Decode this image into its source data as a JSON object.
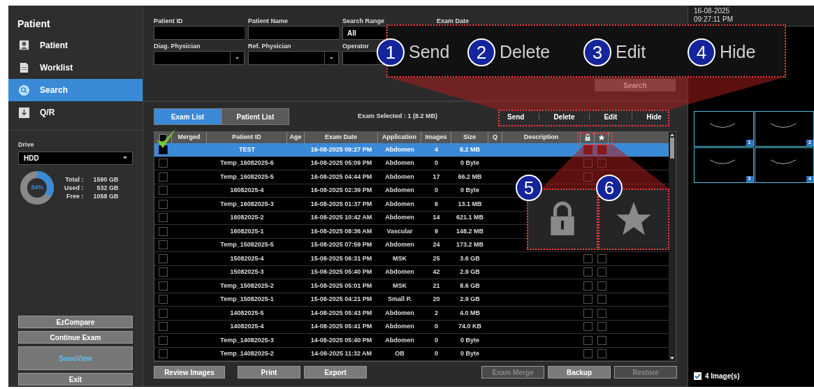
{
  "sidebar": {
    "title": "Patient",
    "items": [
      {
        "label": "Patient",
        "selected": false
      },
      {
        "label": "Worklist",
        "selected": false
      },
      {
        "label": "Search",
        "selected": true
      },
      {
        "label": "Q/R",
        "selected": false
      }
    ],
    "drive": {
      "label": "Drive",
      "value": "HDD",
      "level": 0.34,
      "percent": "34%",
      "stats": [
        {
          "label": "Total :",
          "value": "1590 GB"
        },
        {
          "label": "Used :",
          "value": "532 GB"
        },
        {
          "label": "Free :",
          "value": "1058 GB"
        }
      ]
    },
    "buttons": [
      {
        "label": "EzCompare",
        "kind": "small",
        "active": false
      },
      {
        "label": "Continue Exam",
        "kind": "small",
        "active": false
      },
      {
        "label": "SonoView",
        "kind": "tall",
        "active": true
      },
      {
        "label": "Exit",
        "kind": "small",
        "active": false
      }
    ]
  },
  "search_form": {
    "fields": [
      {
        "label": "Patient ID",
        "kind": "text"
      },
      {
        "label": "Patient Name",
        "kind": "text"
      },
      {
        "label": "Search Range",
        "kind": "value",
        "value": "All"
      },
      {
        "label": "Exam Date",
        "kind": "label"
      },
      {
        "label": "Diag. Physician",
        "kind": "select"
      },
      {
        "label": "Ref. Physician",
        "kind": "select"
      },
      {
        "label": "Operator",
        "kind": "text"
      }
    ],
    "search_button": "Search"
  },
  "tabs": [
    {
      "label": "Exam List",
      "selected": true
    },
    {
      "label": "Patient List",
      "selected": false
    }
  ],
  "exam_selected": "Exam Selected : 1 (8.2 MB)",
  "actions": [
    "Send",
    "Delete",
    "Edit",
    "Hide"
  ],
  "table": {
    "columns": [
      {
        "kind": "checkbox",
        "checked": false
      },
      {
        "kind": "text",
        "label": "Merged"
      },
      {
        "kind": "text",
        "label": "Patient ID"
      },
      {
        "kind": "text",
        "label": "Age"
      },
      {
        "kind": "text",
        "label": "Exam Date"
      },
      {
        "kind": "text",
        "label": "Application"
      },
      {
        "kind": "text",
        "label": "Images"
      },
      {
        "kind": "text",
        "label": "Size"
      },
      {
        "kind": "text",
        "label": "Q"
      },
      {
        "kind": "text",
        "label": "Description"
      },
      {
        "kind": "lock"
      },
      {
        "kind": "star"
      }
    ],
    "rows": [
      {
        "checked": true,
        "selected": true,
        "patient_id": "TEST",
        "exam_date": "16-08-2025 09:27 PM",
        "application": "Abdomen",
        "images": "4",
        "size": "8.2 MB",
        "locked": true,
        "starred": true
      },
      {
        "checked": false,
        "selected": false,
        "patient_id": "Temp_16082025-6",
        "exam_date": "16-08-2025 05:09 PM",
        "application": "Abdomen",
        "images": "0",
        "size": "0 Byte",
        "locked": false,
        "starred": false
      },
      {
        "checked": false,
        "selected": false,
        "patient_id": "Temp_16082025-5",
        "exam_date": "16-08-2025 04:44 PM",
        "application": "Abdomen",
        "images": "17",
        "size": "66.2 MB",
        "locked": false
      },
      {
        "checked": false,
        "selected": false,
        "patient_id": "16082025-4",
        "exam_date": "16-08-2025 02:39 PM",
        "application": "Abdomen",
        "images": "0",
        "size": "0 Byte"
      },
      {
        "checked": false,
        "selected": false,
        "patient_id": "Temp_16082025-3",
        "exam_date": "16-08-2025 01:37 PM",
        "application": "Abdomen",
        "images": "6",
        "size": "13.1 MB"
      },
      {
        "checked": false,
        "selected": false,
        "patient_id": "16082025-2",
        "exam_date": "16-08-2025 10:42 AM",
        "application": "Abdomen",
        "images": "14",
        "size": "621.1 MB"
      },
      {
        "checked": false,
        "selected": false,
        "patient_id": "16082025-1",
        "exam_date": "16-08-2025 08:36 AM",
        "application": "Vascular",
        "images": "9",
        "size": "148.2 MB"
      },
      {
        "checked": false,
        "selected": false,
        "patient_id": "Temp_15082025-5",
        "exam_date": "15-08-2025 07:59 PM",
        "application": "Abdomen",
        "images": "24",
        "size": "173.2 MB"
      },
      {
        "checked": false,
        "selected": false,
        "patient_id": "15082025-4",
        "exam_date": "15-08-2025 06:31 PM",
        "application": "MSK",
        "images": "25",
        "size": "3.6 GB",
        "locked": false,
        "starred": false
      },
      {
        "checked": false,
        "selected": false,
        "patient_id": "15082025-3",
        "exam_date": "15-08-2025 05:40 PM",
        "application": "Abdomen",
        "images": "42",
        "size": "2.9 GB",
        "locked": false,
        "starred": false
      },
      {
        "checked": false,
        "selected": false,
        "patient_id": "Temp_15082025-2",
        "exam_date": "15-08-2025 05:01 PM",
        "application": "MSK",
        "images": "21",
        "size": "8.6 GB",
        "locked": false,
        "starred": false
      },
      {
        "checked": false,
        "selected": false,
        "patient_id": "Temp_15082025-1",
        "exam_date": "15-08-2025 04:21 PM",
        "application": "Small P.",
        "images": "20",
        "size": "2.9 GB",
        "locked": false,
        "starred": false
      },
      {
        "checked": false,
        "selected": false,
        "patient_id": "14082025-5",
        "exam_date": "14-08-2025 05:43 PM",
        "application": "Abdomen",
        "images": "2",
        "size": "4.0 MB",
        "locked": false,
        "starred": false
      },
      {
        "checked": false,
        "selected": false,
        "patient_id": "14082025-4",
        "exam_date": "14-08-2025 05:41 PM",
        "application": "Abdomen",
        "images": "0",
        "size": "74.0 KB",
        "locked": false,
        "starred": false
      },
      {
        "checked": false,
        "selected": false,
        "patient_id": "Temp_14082025-3",
        "exam_date": "14-08-2025 05:40 PM",
        "application": "Abdomen",
        "images": "0",
        "size": "0 Byte",
        "locked": false,
        "starred": false
      },
      {
        "checked": false,
        "selected": false,
        "patient_id": "Temp_14082025-2",
        "exam_date": "14-08-2025 11:32 AM",
        "application": "OB",
        "images": "0",
        "size": "0 Byte",
        "locked": false,
        "starred": false
      }
    ]
  },
  "bottom_buttons": [
    {
      "label": "Review Images",
      "disabled": false
    },
    {
      "label": "Print",
      "disabled": false
    },
    {
      "label": "Export",
      "disabled": false
    },
    {
      "label": "Exam Merge",
      "disabled": true
    },
    {
      "label": "Backup",
      "disabled": false
    },
    {
      "label": "Restore",
      "disabled": true
    }
  ],
  "right_panel": {
    "date": "16-08-2025",
    "time": "09:27:11 PM",
    "thumbnails": [
      {
        "number": "1"
      },
      {
        "number": "2"
      },
      {
        "number": "3"
      },
      {
        "number": "4"
      }
    ],
    "image_count": {
      "label": "4 Image(s)",
      "checked": true
    }
  },
  "callouts": {
    "actions": [
      {
        "number": "1",
        "label": "Send"
      },
      {
        "number": "2",
        "label": "Delete"
      },
      {
        "number": "3",
        "label": "Edit"
      },
      {
        "number": "4",
        "label": "Hide"
      }
    ],
    "icons": [
      {
        "number": "5",
        "kind": "lock"
      },
      {
        "number": "6",
        "kind": "star"
      }
    ]
  }
}
